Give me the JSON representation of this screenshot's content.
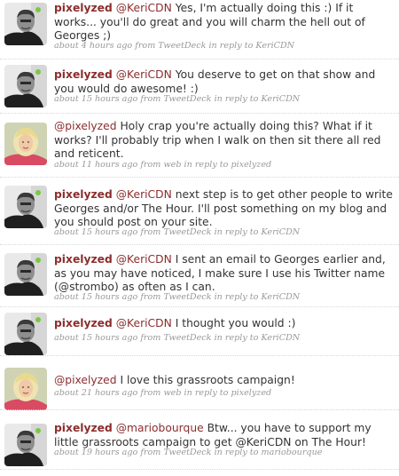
{
  "tweets": [
    {
      "username": "pixelyzed",
      "avatar": "man-avatar",
      "mention": "@KeriCDN",
      "text": "Yes, I'm actually doing this :) If it works... you'll do great and you will charm the hell out of Georges ;)",
      "time": "about 4 hours ago",
      "from_label": "from",
      "source": "TweetDeck",
      "reply_label": "in reply to",
      "reply_to": "KeriCDN"
    },
    {
      "username": "pixelyzed",
      "avatar": "man-avatar",
      "mention": "@KeriCDN",
      "text": "You deserve to get on that show and you would do awesome! :)",
      "time": "about 15 hours ago",
      "from_label": "from",
      "source": "TweetDeck",
      "reply_label": "in reply to",
      "reply_to": "KeriCDN"
    },
    {
      "username": "",
      "avatar": "woman-avatar",
      "mention": "@pixelyzed",
      "text": "Holy crap you're actually doing this? What if it works? I'll probably trip when I walk on then sit there all red and reticent.",
      "time": "about 11 hours ago",
      "from_label": "from",
      "source": "web",
      "reply_label": "in reply to",
      "reply_to": "pixelyzed"
    },
    {
      "username": "pixelyzed",
      "avatar": "man-avatar",
      "mention": "@KeriCDN",
      "text": "next step is to get other people to write Georges and/or The Hour. I'll post something on my blog and you should post on your site.",
      "time": "about 15 hours ago",
      "from_label": "from",
      "source": "TweetDeck",
      "reply_label": "in reply to",
      "reply_to": "KeriCDN"
    },
    {
      "username": "pixelyzed",
      "avatar": "man-avatar",
      "mention": "@KeriCDN",
      "text": "I sent an email to Georges earlier and, as you may have noticed, I make sure I use his Twitter name (@strombo) as often as I can.",
      "time": "about 15 hours ago",
      "from_label": "from",
      "source": "TweetDeck",
      "reply_label": "in reply to",
      "reply_to": "KeriCDN"
    },
    {
      "username": "pixelyzed",
      "avatar": "man-avatar",
      "mention": "@KeriCDN",
      "text": "I thought you would :)",
      "time": "about 15 hours ago",
      "from_label": "from",
      "source": "TweetDeck",
      "reply_label": "in reply to",
      "reply_to": "KeriCDN"
    },
    {
      "username": "",
      "avatar": "woman-avatar",
      "mention": "@pixelyzed",
      "text": "I love this grassroots campaign!",
      "time": "about 21 hours ago",
      "from_label": "from",
      "source": "web",
      "reply_label": "in reply to",
      "reply_to": "pixelyzed"
    },
    {
      "username": "pixelyzed",
      "avatar": "man-avatar",
      "mention": "@mariobourque",
      "text": "Btw... you have to support my little grassroots campaign to get @KeriCDN on The Hour!",
      "time": "about 19 hours ago",
      "from_label": "from",
      "source": "TweetDeck",
      "reply_label": "in reply to",
      "reply_to": "mariobourque"
    }
  ],
  "colors": {
    "username": "#8c2d2d",
    "mention": "#8c2d2d",
    "meta": "#999999",
    "online_dot": "#7ac943",
    "divider": "#d8d8d8"
  }
}
